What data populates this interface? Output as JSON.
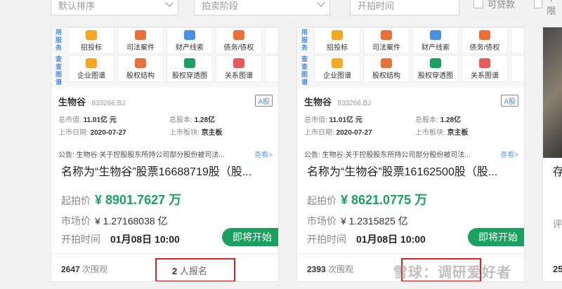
{
  "filters": {
    "sort": "默认排序",
    "stage": "拍卖阶段",
    "start_time_placeholder": "开拍时间",
    "loan": "可贷款",
    "other": "不限"
  },
  "services": {
    "label_1": "用服务",
    "label_2": "查查图谱",
    "row1": [
      "招投标",
      "司法案件",
      "财产线索",
      "债务/债权",
      "深"
    ],
    "row2": [
      "企业图谱",
      "股权结构",
      "股权穿透图",
      "关系图谱",
      "实"
    ]
  },
  "cards": [
    {
      "stock_name": "生物谷",
      "stock_code": "833266.BJ",
      "tag": "A股",
      "total_mv_label": "总市值:",
      "total_mv": "11.01亿 元",
      "total_shares_label": "总股本:",
      "total_shares": "1.28亿",
      "listed_label": "上市日期:",
      "listed": "2020-07-27",
      "board_label": "上市板块:",
      "board": "京主板",
      "notice": "公告:  生物谷:关于控股股东所持公司部分股份被司法...",
      "notice_more": "查看>",
      "title": "名称为“生物谷”股票16688719股（股...",
      "start_price_label": "起拍价",
      "start_price": "¥ 8901.7627 万",
      "market_label": "市场价",
      "market_value": "¥ 1.27168038 亿",
      "time_label": "开拍时间",
      "time_value": "01月08日 10:00",
      "badge": "即将开始",
      "views_count": "2647",
      "views_unit": "次围观",
      "signup_count": "2",
      "signup_unit": "人报名"
    },
    {
      "stock_name": "生物谷",
      "stock_code": "833266.BJ",
      "tag": "A股",
      "total_mv_label": "总市值:",
      "total_mv": "11.01亿 元",
      "total_shares_label": "总股本:",
      "total_shares": "1.28亿",
      "listed_label": "上市日期:",
      "listed": "2020-07-27",
      "board_label": "上市板块:",
      "board": "京主板",
      "notice": "公告:  生物谷:关于控股股东所持公司部分股份被司法...",
      "notice_more": "查看>",
      "title": "名称为“生物谷”股票16162500股（股...",
      "start_price_label": "起拍价",
      "start_price": "¥ 8621.0775 万",
      "market_label": "市场价",
      "market_value": "¥ 1.2315825 亿",
      "time_label": "开拍时间",
      "time_value": "01月08日 10:00",
      "badge": "即将开始",
      "views_count": "2393",
      "views_unit": "次围观",
      "signup_count": "",
      "signup_unit": ""
    }
  ],
  "card3": {
    "title_char": "存",
    "row_char": "评",
    "views_partial": "25"
  },
  "watermark": "雪球：调研爱好者",
  "colors": {
    "accent_green": "#1aa15f",
    "link_blue": "#4a90e2",
    "highlight_red": "#e02020"
  }
}
